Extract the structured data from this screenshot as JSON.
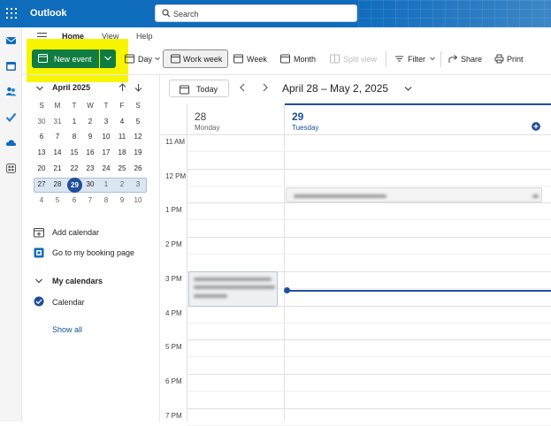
{
  "app": {
    "title": "Outlook"
  },
  "search": {
    "placeholder": "Search"
  },
  "ribbon": {
    "tabs": [
      "Home",
      "View",
      "Help"
    ],
    "new_event_label": "New event",
    "day_label": "Day",
    "work_week_label": "Work week",
    "week_label": "Week",
    "month_label": "Month",
    "split_view_label": "Split view",
    "filter_label": "Filter",
    "share_label": "Share",
    "print_label": "Print"
  },
  "mini_calendar": {
    "title": "April 2025",
    "weekdays": [
      "S",
      "M",
      "T",
      "W",
      "T",
      "F",
      "S"
    ],
    "weeks": [
      [
        "30",
        "31",
        "1",
        "2",
        "3",
        "4",
        "5"
      ],
      [
        "6",
        "7",
        "8",
        "9",
        "10",
        "11",
        "12"
      ],
      [
        "13",
        "14",
        "15",
        "16",
        "17",
        "18",
        "19"
      ],
      [
        "20",
        "21",
        "22",
        "23",
        "24",
        "25",
        "26"
      ],
      [
        "27",
        "28",
        "29",
        "30",
        "1",
        "2",
        "3"
      ],
      [
        "4",
        "5",
        "6",
        "7",
        "8",
        "9",
        "10"
      ]
    ],
    "today": "29"
  },
  "sidebar": {
    "add_calendar": "Add calendar",
    "booking_page": "Go to my booking page",
    "my_calendars": "My calendars",
    "calendar_item": "Calendar",
    "show_all": "Show all"
  },
  "calendar": {
    "today_label": "Today",
    "range": "April 28 – May 2, 2025",
    "days": [
      {
        "num": "28",
        "name": "Monday"
      },
      {
        "num": "29",
        "name": "Tuesday"
      }
    ],
    "times": [
      "11 AM",
      "12 PM",
      "1 PM",
      "2 PM",
      "3 PM",
      "4 PM",
      "5 PM",
      "6 PM",
      "7 PM"
    ]
  },
  "colors": {
    "brand": "#0f6cbd",
    "new_event": "#107c41",
    "highlight": "#f8f500",
    "accent": "#1f4e9c"
  }
}
